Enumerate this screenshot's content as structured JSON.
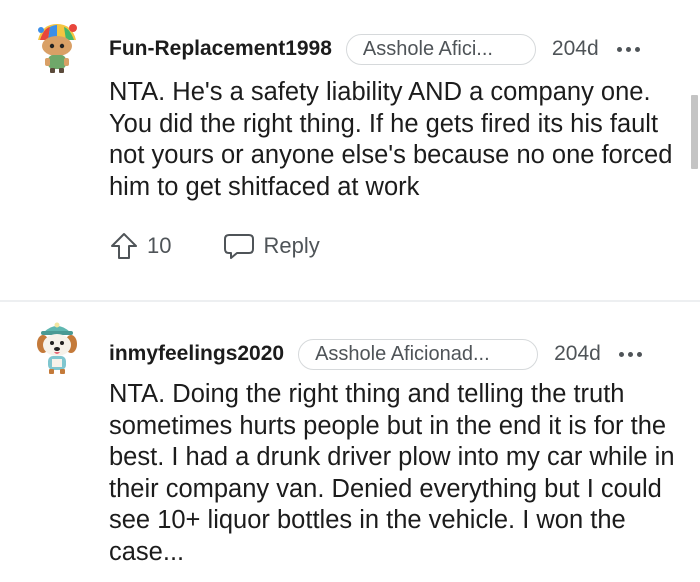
{
  "comments": [
    {
      "username": "Fun-Replacement1998",
      "flair": "Asshole Afici...",
      "age": "204d",
      "body": "NTA. He's a safety liability AND a company one. You did the right thing. If he gets fired its his fault not yours or anyone else's because no one forced him to get shitfaced at work",
      "votes": "10",
      "reply_label": "Reply"
    },
    {
      "username": "inmyfeelings2020",
      "flair": "Asshole Aficionad...",
      "age": "204d",
      "body": "NTA. Doing the right thing and telling the truth sometimes hurts people but in the end it is for the best. I had a drunk driver plow into my car while in their company van. Denied everything but I could see 10+ liquor bottles in the vehicle. I won the case..."
    }
  ],
  "icons": {
    "upvote": "upvote-arrow-icon",
    "reply": "speech-bubble-icon",
    "more": "more-options-icon"
  },
  "colors": {
    "text": "#1c1c1c",
    "meta": "#4f5458",
    "divider": "#edeff1"
  }
}
